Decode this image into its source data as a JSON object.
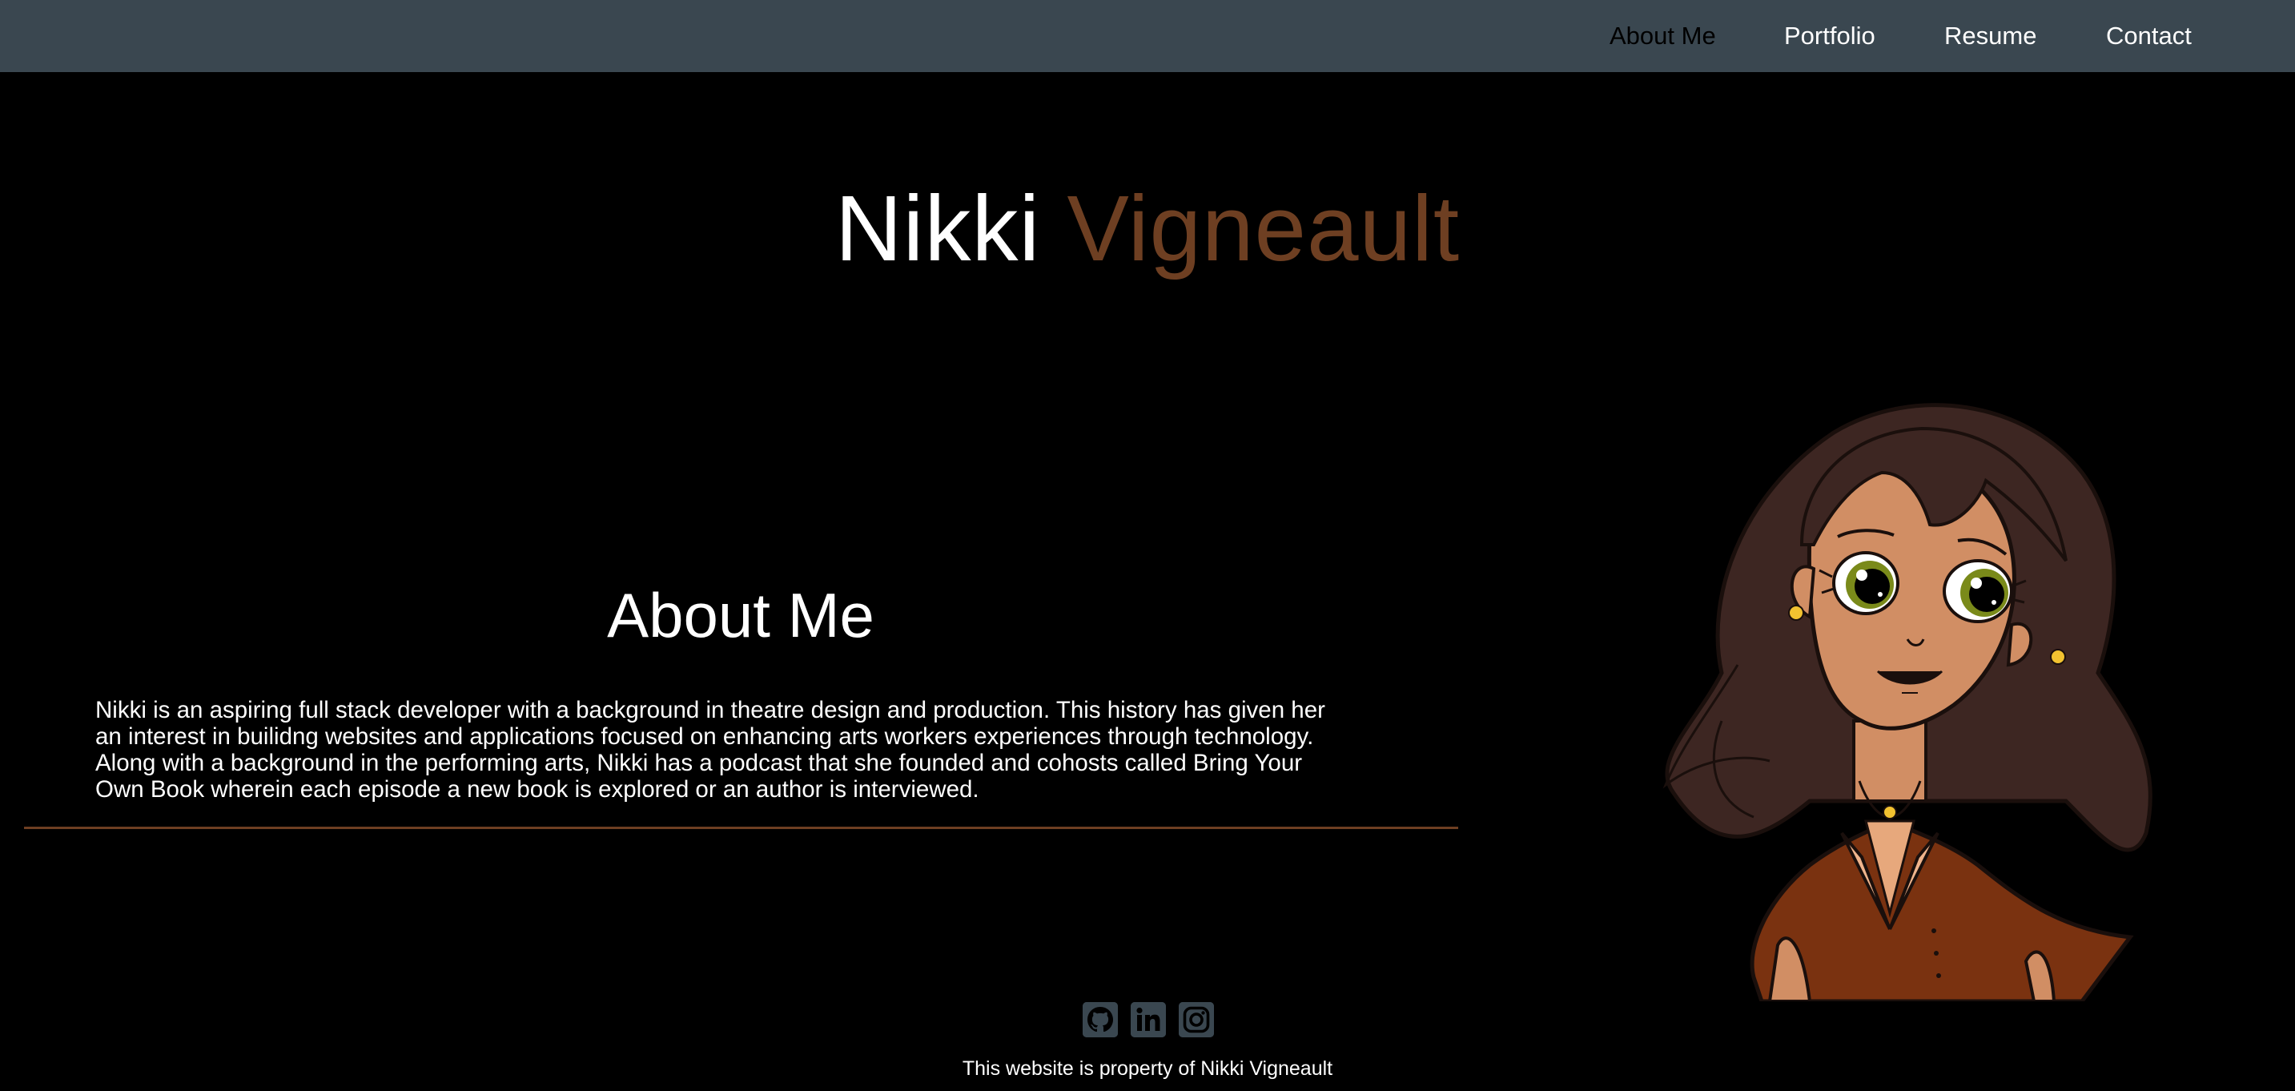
{
  "nav": {
    "items": [
      {
        "label": "About Me",
        "active": true
      },
      {
        "label": "Portfolio",
        "active": false
      },
      {
        "label": "Resume",
        "active": false
      },
      {
        "label": "Contact",
        "active": false
      }
    ]
  },
  "header": {
    "first_name": "Nikki",
    "last_name": "Vigneault"
  },
  "about": {
    "title": "About Me",
    "paragraphs": [
      "Nikki is an aspiring full stack developer with a background in theatre design and production. This history has given her an interest in builidng websites and applications focused on enhancing arts workers experiences through technology.",
      "Along with a background in the performing arts, Nikki has a podcast that she founded and cohosts called Bring Your Own Book wherein each episode a new book is explored or an author is interviewed."
    ]
  },
  "social": {
    "icons": [
      "github-icon",
      "linkedin-icon",
      "instagram-icon"
    ]
  },
  "footer": {
    "text": "This website is property of Nikki Vigneault"
  },
  "colors": {
    "navbar": "#3a4750",
    "background": "#000000",
    "accent": "#6e3f22",
    "text": "#ffffff"
  }
}
